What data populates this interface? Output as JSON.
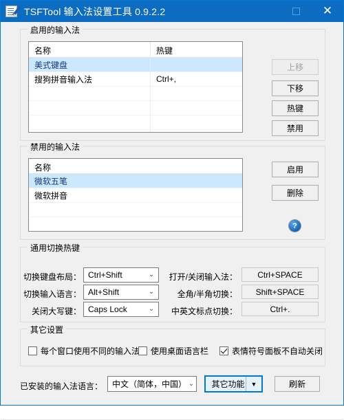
{
  "window": {
    "title": "TSFTool 输入法设置工具 0.9.2.2",
    "icon": "notepad-pen-icon",
    "accent_color": "#0c6cc1",
    "maximize_label": "",
    "close_label": "✕"
  },
  "enabled_group": {
    "title": "启用的输入法",
    "columns": [
      "名称",
      "热键"
    ],
    "rows": [
      {
        "name": "美式键盘",
        "hotkey": "",
        "selected": true
      },
      {
        "name": "搜狗拼音输入法",
        "hotkey": "Ctrl+,",
        "selected": false
      }
    ],
    "buttons": {
      "move_up": "上移",
      "move_down": "下移",
      "hotkey": "热键",
      "disable": "禁用"
    },
    "move_up_disabled": true
  },
  "disabled_group": {
    "title": "禁用的输入法",
    "columns": [
      "名称"
    ],
    "rows": [
      {
        "name": "微软五笔",
        "selected": true
      },
      {
        "name": "微软拼音",
        "selected": false
      }
    ],
    "buttons": {
      "enable": "启用",
      "delete": "删除"
    },
    "help_label": "?"
  },
  "hotkeys_group": {
    "title": "通用切换热键",
    "left": [
      {
        "label": "切换键盘布局：",
        "value": "Ctrl+Shift"
      },
      {
        "label": "切换输入语言：",
        "value": "Alt+Shift"
      },
      {
        "label": "关闭大写键：",
        "value": "Caps Lock"
      }
    ],
    "right": [
      {
        "label": "打开/关闭输入法：",
        "value": "Ctrl+SPACE"
      },
      {
        "label": "全角/半角切换：",
        "value": "Shift+SPACE"
      },
      {
        "label": "中英文标点切换：",
        "value": "Ctrl+."
      }
    ]
  },
  "other_group": {
    "title": "其它设置",
    "checkboxes": [
      {
        "label": "每个窗口使用不同的输入法",
        "checked": false
      },
      {
        "label": "使用桌面语言栏",
        "checked": false
      },
      {
        "label": "表情符号面板不自动关闭",
        "checked": true
      }
    ]
  },
  "footer": {
    "language_label": "已安装的输入法语言：",
    "language_value": "中文（简体，中国）",
    "other_functions": "其它功能",
    "split_arrow": "▼",
    "refresh": "刷新"
  }
}
